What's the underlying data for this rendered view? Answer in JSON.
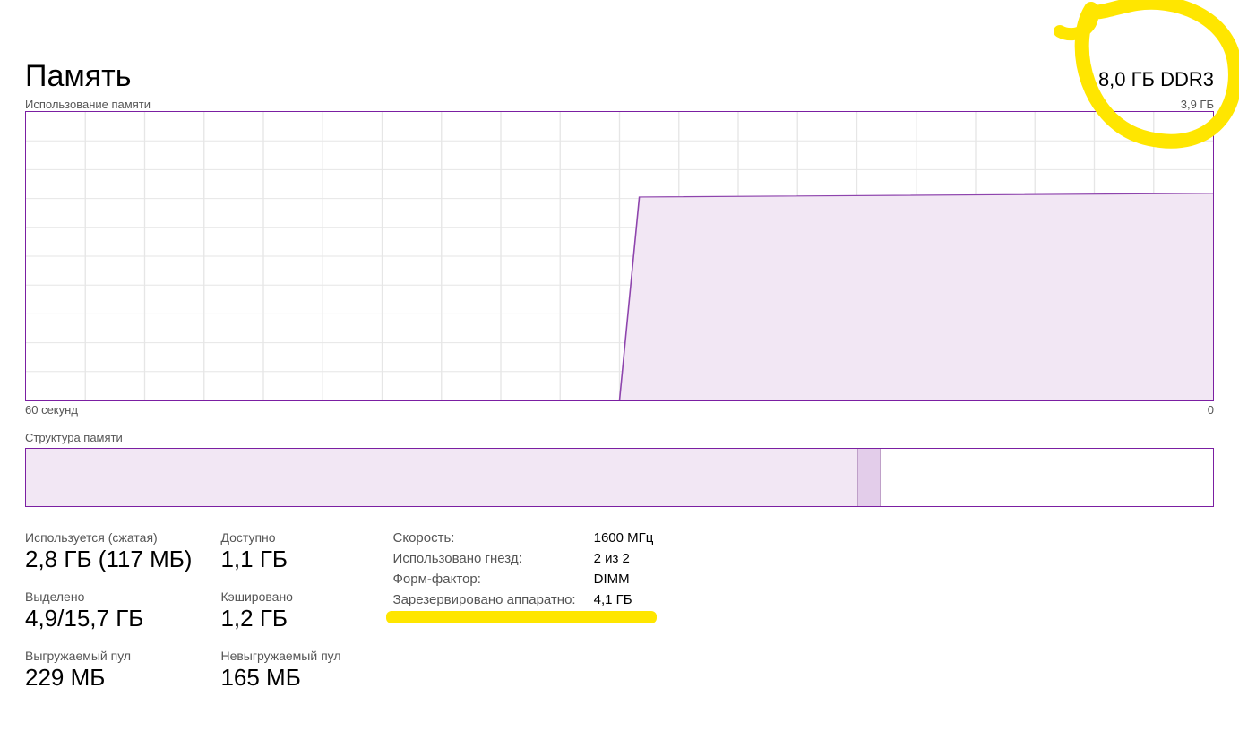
{
  "header": {
    "title": "Память",
    "total": "8,0 ГБ DDR3"
  },
  "chart": {
    "top_left_label": "Использование памяти",
    "top_right_label": "3,9 ГБ",
    "bottom_left_label": "60 секунд",
    "bottom_right_label": "0"
  },
  "chart_data": {
    "type": "area",
    "ylim": [
      0,
      3.9
    ],
    "xlim_seconds": [
      60,
      0
    ],
    "ylabel": "ГБ",
    "series": [
      {
        "name": "usage",
        "points": [
          {
            "t": 60,
            "v": 0.0
          },
          {
            "t": 30,
            "v": 0.0
          },
          {
            "t": 29,
            "v": 2.75
          },
          {
            "t": 0,
            "v": 2.8
          }
        ]
      }
    ]
  },
  "composition": {
    "label": "Структура памяти",
    "segments": [
      {
        "kind": "used",
        "fraction": 0.7
      },
      {
        "kind": "modified",
        "fraction": 0.02
      },
      {
        "kind": "free",
        "fraction": 0.28
      }
    ]
  },
  "stats_left": [
    {
      "label": "Используется (сжатая)",
      "value": "2,8 ГБ (117 МБ)"
    },
    {
      "label": "Доступно",
      "value": "1,1 ГБ"
    },
    {
      "label": "Выделено",
      "value": "4,9/15,7 ГБ"
    },
    {
      "label": "Кэшировано",
      "value": "1,2 ГБ"
    },
    {
      "label": "Выгружаемый пул",
      "value": "229 МБ"
    },
    {
      "label": "Невыгружаемый пул",
      "value": "165 МБ"
    }
  ],
  "stats_right": [
    {
      "k": "Скорость:",
      "v": "1600 МГц"
    },
    {
      "k": "Использовано гнезд:",
      "v": "2 из 2"
    },
    {
      "k": "Форм-фактор:",
      "v": "DIMM"
    },
    {
      "k": "Зарезервировано аппаратно:",
      "v": "4,1 ГБ"
    }
  ]
}
